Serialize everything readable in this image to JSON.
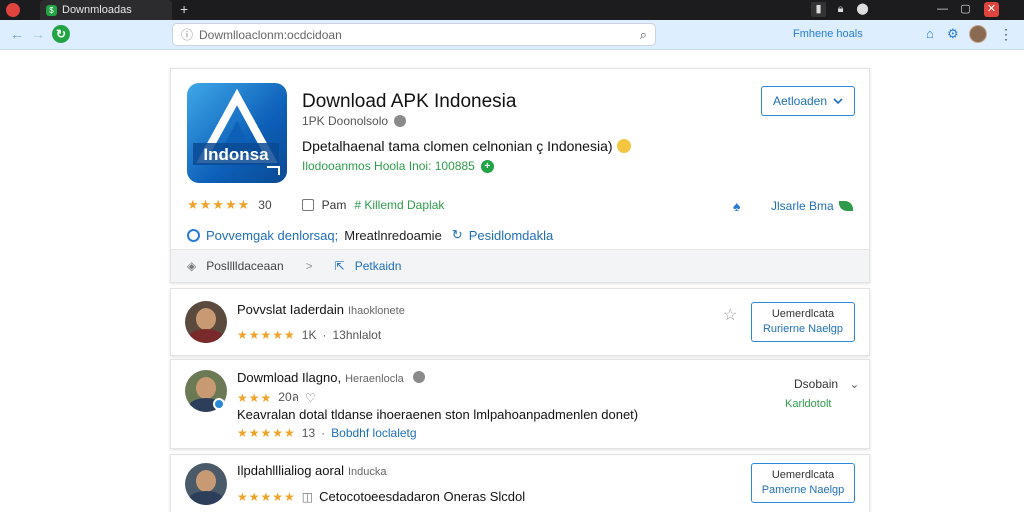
{
  "browser": {
    "tab_title": "Downmloadas",
    "tab_favicon": "$",
    "new_tab": "+",
    "address": "Dowmlloaclonm:ocdcidoan",
    "toolbar_link": "Fmhene hoals",
    "window_icons": [
      "pin-icon",
      "lock-icon",
      "bell-icon",
      "minimize-icon",
      "restore-icon",
      "close-icon"
    ]
  },
  "app": {
    "title": "Download APK Indonesia",
    "developer": "1PK Doonolsolo",
    "description": "Dpetalhaenal tama clomen celnonian ç Indonesia)",
    "meta": "Ilodooanmos Hoola Inoi: 100885",
    "install_label": "Aetloaden",
    "icon_text": "Indonsa",
    "rating_stars": "★★★★★",
    "rating_count": "30",
    "check_label": "Pam",
    "check_link": "# Killemd Daplak",
    "share_label": "Jlsarle Bma",
    "link_dark": "Povvemgak denlorsaq;",
    "link_blue1": "Mreatlnredoamie",
    "link_blue2": "Pesidlomdakla",
    "footer_left": "Poslllldaceaan",
    "footer_sep": ">",
    "footer_link": "Petkaidn"
  },
  "reviews": [
    {
      "name": "Povvslat Iaderdain",
      "sub": "Ihaoklonete",
      "stars": "★★★★★",
      "count": "1K",
      "meta": "13hnlalot",
      "btn_line1": "Uemerdlcata",
      "btn_line2": "Rurierne Naelgp"
    },
    {
      "name": "Dowmload Ilagno,",
      "sub": "Heraenlocla",
      "stars": "★★★",
      "count": "20ล",
      "body": "Keavralan dotal tldanse ihoeraenen ston lmlpahoanpadmenlen donet)",
      "stars2": "★★★★★",
      "count2": "13",
      "link": "Bobdhf loclaletg",
      "dropdown": "Dsobain",
      "green": "Karldotolt"
    },
    {
      "name": "Ilpdahlllialiog aoral",
      "sub": "Inducka",
      "stars": "★★★★★",
      "count": "",
      "body": "Cetocotoeesdadaron Oneras Slcdol",
      "btn_line1": "Uemerdlcata",
      "btn_line2": "Pamerne Naelgp"
    }
  ],
  "colors": {
    "accent_blue": "#2a88d6",
    "accent_green": "#22a445",
    "star": "#f0a32a",
    "tabbar": "#1c1c1e",
    "toolbar": "#dceeff"
  }
}
